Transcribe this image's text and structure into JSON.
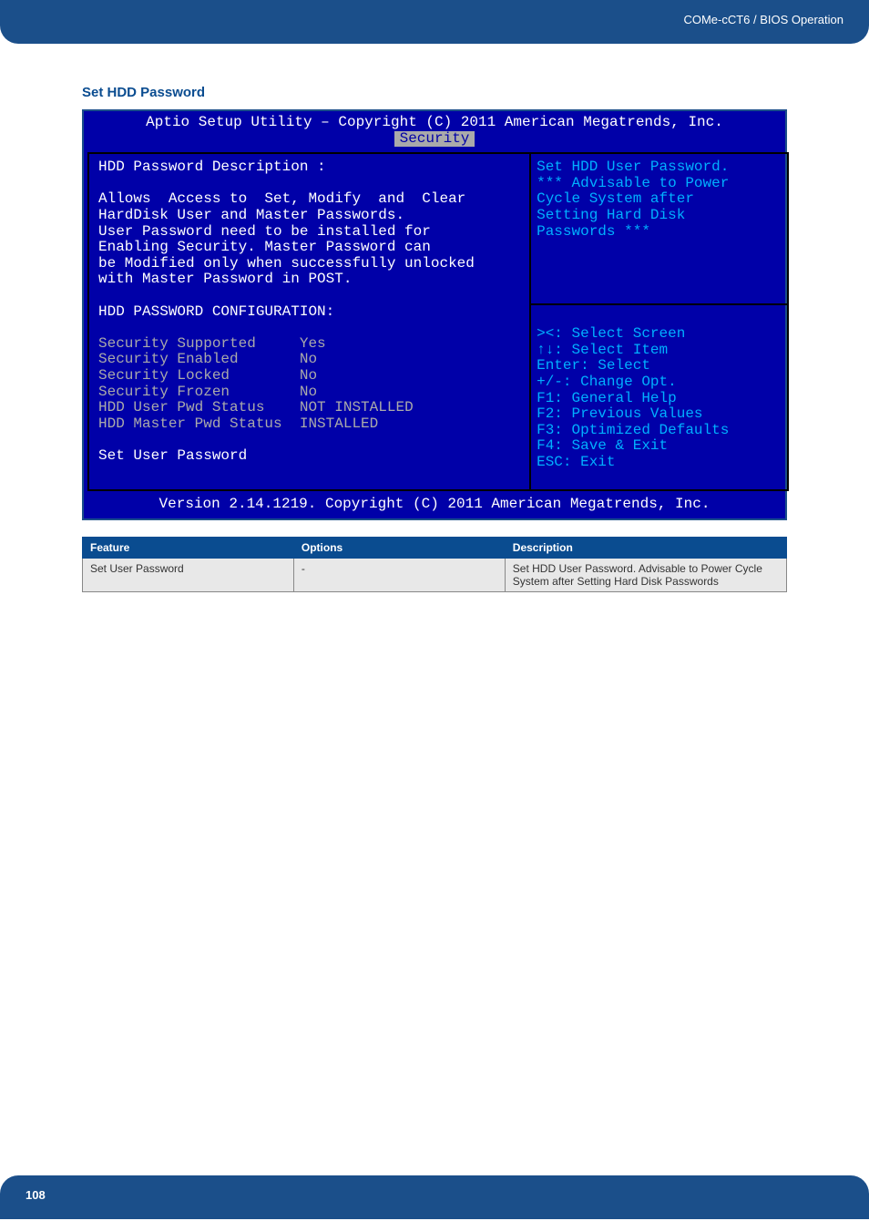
{
  "header_text": "COMe-cCT6 / BIOS Operation",
  "section_title": "Set HDD Password",
  "bios": {
    "title": "Aptio Setup Utility – Copyright (C) 2011 American Megatrends, Inc.",
    "active_tab": "Security",
    "left_title": "HDD Password Description :",
    "left_desc_line1": "Allows  Access to  Set, Modify  and  Clear",
    "left_desc_line2": "HardDisk User and Master Passwords.",
    "left_desc_line3": "User Password need to be installed for",
    "left_desc_line4": "Enabling Security. Master Password can",
    "left_desc_line5": "be Modified only when successfully unlocked",
    "left_desc_line6": "with Master Password in POST.",
    "config_header": "HDD PASSWORD CONFIGURATION:",
    "items": [
      {
        "label": "Security Supported",
        "value": "Yes"
      },
      {
        "label": "Security Enabled",
        "value": "No"
      },
      {
        "label": "Security Locked",
        "value": "No"
      },
      {
        "label": "Security Frozen",
        "value": "No"
      },
      {
        "label": "HDD User Pwd Status",
        "value": "NOT INSTALLED"
      },
      {
        "label": "HDD Master Pwd Status",
        "value": "INSTALLED"
      }
    ],
    "selected_item": "Set User Password",
    "help_line1": "Set HDD User Password.",
    "help_line2": "*** Advisable to Power",
    "help_line3": "Cycle System after",
    "help_line4": "Setting Hard Disk",
    "help_line5": "Passwords ***",
    "nav_line1": "><: Select Screen",
    "nav_line2": "↑↓: Select Item",
    "nav_line3": "Enter: Select",
    "nav_line4": "+/-: Change Opt.",
    "nav_line5": "F1: General Help",
    "nav_line6": "F2: Previous Values",
    "nav_line7": "F3: Optimized Defaults",
    "nav_line8": "F4: Save & Exit",
    "nav_line9": "ESC: Exit",
    "footer": "Version 2.14.1219. Copyright (C) 2011 American Megatrends, Inc."
  },
  "table": {
    "headers": [
      "Feature",
      "Options",
      "Description"
    ],
    "rows": [
      {
        "feature": "Set User Password",
        "options": "-",
        "description": "Set HDD User Password. Advisable to Power Cycle System after Setting Hard Disk Passwords"
      }
    ]
  },
  "page_number": "108"
}
